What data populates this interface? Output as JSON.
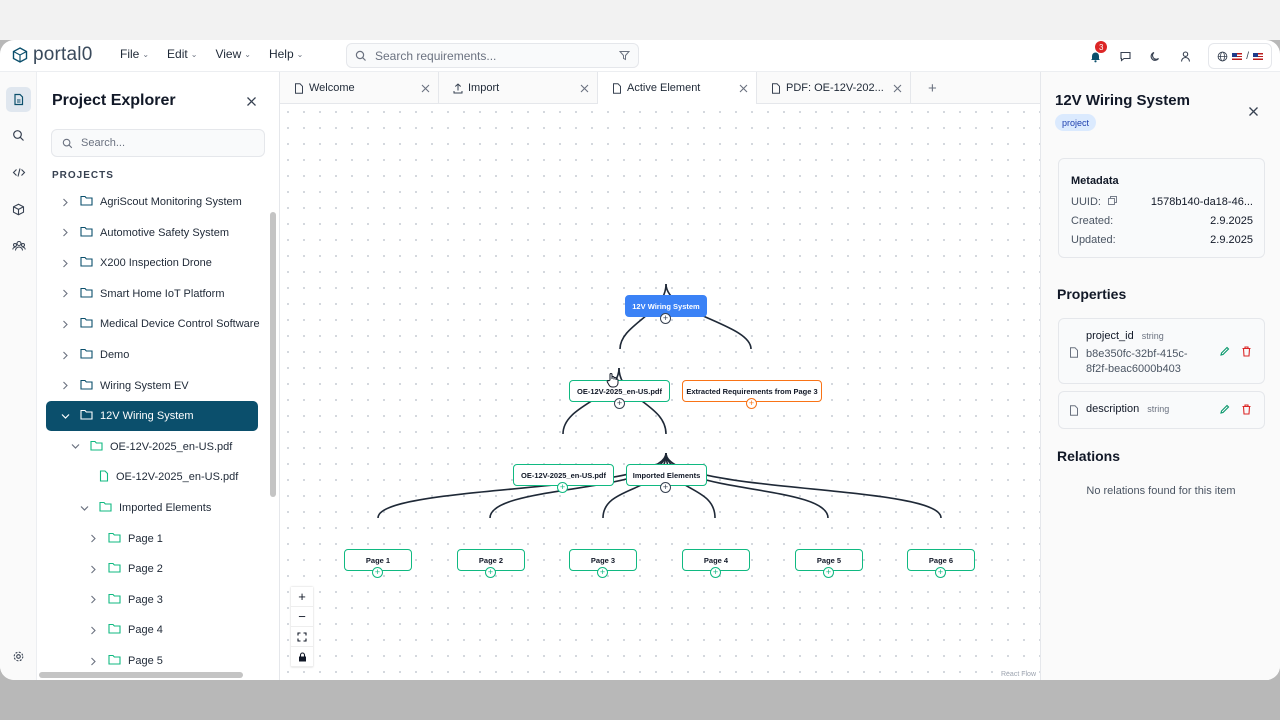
{
  "app": {
    "brand": "portal0",
    "notification_count": "3",
    "lang_separator": "/"
  },
  "menu": [
    "File",
    "Edit",
    "View",
    "Help"
  ],
  "search": {
    "placeholder": "Search requirements..."
  },
  "explorer": {
    "title": "Project Explorer",
    "search_placeholder": "Search...",
    "projects_header": "PROJECTS",
    "items": [
      {
        "label": "AgriScout Monitoring System",
        "level": 0,
        "expanded": false
      },
      {
        "label": "Automotive Safety System",
        "level": 0,
        "expanded": false
      },
      {
        "label": "X200 Inspection Drone",
        "level": 0,
        "expanded": false
      },
      {
        "label": "Smart Home IoT Platform",
        "level": 0,
        "expanded": false
      },
      {
        "label": "Medical Device Control Software",
        "level": 0,
        "expanded": false
      },
      {
        "label": "Demo",
        "level": 0,
        "expanded": false
      },
      {
        "label": "Wiring System EV",
        "level": 0,
        "expanded": false
      },
      {
        "label": "12V Wiring System",
        "level": 0,
        "expanded": true,
        "selected": true
      },
      {
        "label": "OE-12V-2025_en-US.pdf",
        "level": 1,
        "expanded": true
      },
      {
        "label": "OE-12V-2025_en-US.pdf",
        "level": 2,
        "file": true
      },
      {
        "label": "Imported Elements",
        "level": 2,
        "expanded": true
      },
      {
        "label": "Page 1",
        "level": 3,
        "expanded": false
      },
      {
        "label": "Page 2",
        "level": 3,
        "expanded": false
      },
      {
        "label": "Page 3",
        "level": 3,
        "expanded": false
      },
      {
        "label": "Page 4",
        "level": 3,
        "expanded": false
      },
      {
        "label": "Page 5",
        "level": 3,
        "expanded": false
      }
    ]
  },
  "tabs": [
    {
      "label": "Welcome",
      "icon": "file-icon",
      "active": false
    },
    {
      "label": "Import",
      "icon": "upload-icon",
      "active": false
    },
    {
      "label": "Active Element",
      "icon": "file-icon",
      "active": true
    },
    {
      "label": "PDF: OE-12V-202...",
      "icon": "file-icon",
      "active": false
    }
  ],
  "tab_add": "+",
  "flow": {
    "nodes": {
      "root": "12V Wiring System",
      "pdf_a": "OE-12V-2025_en-US.pdf",
      "extracted": "Extracted Requirements from Page 3",
      "pdf_b": "OE-12V-2025_en-US.pdf",
      "imported": "Imported Elements",
      "pages": [
        "Page 1",
        "Page 2",
        "Page 3",
        "Page 4",
        "Page 5",
        "Page 6"
      ]
    },
    "controls": [
      "+",
      "−"
    ],
    "attribution": "React Flow"
  },
  "details": {
    "title": "12V Wiring System",
    "badge": "project",
    "metadata": {
      "title": "Metadata",
      "uuid_label": "UUID:",
      "uuid_value": "1578b140-da18-46...",
      "created_label": "Created:",
      "created_value": "2.9.2025",
      "updated_label": "Updated:",
      "updated_value": "2.9.2025"
    },
    "properties_title": "Properties",
    "properties": [
      {
        "key": "project_id",
        "type": "string",
        "value": "b8e350fc-32bf-415c-8f2f-beac6000b403"
      },
      {
        "key": "description",
        "type": "string",
        "value": ""
      }
    ],
    "relations_title": "Relations",
    "relations_empty": "No relations found for this item"
  },
  "colors": {
    "accent": "#0b4f6c",
    "root_node": "#3b82f6",
    "node_border": "#10b981",
    "orange_node": "#f97316",
    "danger": "#dc2626"
  }
}
